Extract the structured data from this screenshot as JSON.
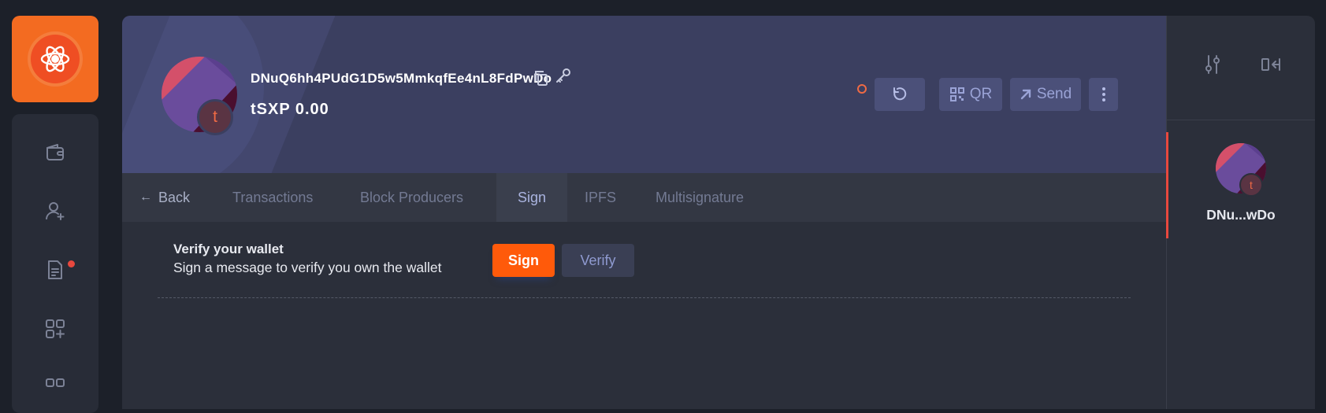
{
  "app": {
    "brand_color": "#f36b21",
    "logo_icon": "ark-logo-icon"
  },
  "left_nav": {
    "items": [
      {
        "name": "wallet-icon",
        "label": ""
      },
      {
        "name": "add-contact-icon",
        "label": ""
      },
      {
        "name": "document-icon",
        "label": "",
        "has_notification": true
      },
      {
        "name": "plugins-add-icon",
        "label": ""
      },
      {
        "name": "apps-grid-icon",
        "label": ""
      }
    ]
  },
  "wallet": {
    "address": "DNuQ6hh4PUdG1D5w5MmkqfEe4nL8FdPwDo",
    "balance": "tSXP 0.00",
    "avatar_letter": "t",
    "short_address": "DNu...wDo"
  },
  "header_actions": {
    "refresh_icon": "refresh-icon",
    "qr_label": "QR",
    "send_label": "Send",
    "more_icon": "more-vertical-icon"
  },
  "tabs": {
    "back_label": "Back",
    "items": [
      {
        "label": "Transactions",
        "active": false
      },
      {
        "label": "Block Producers",
        "active": false
      },
      {
        "label": "Sign",
        "active": true
      },
      {
        "label": "IPFS",
        "active": false
      },
      {
        "label": "Multisignature",
        "active": false
      }
    ]
  },
  "sign_section": {
    "title": "Verify your wallet",
    "description": "Sign a message to verify you own the wallet",
    "sign_button": "Sign",
    "verify_button": "Verify"
  },
  "colors": {
    "accent_orange": "#ff5a0a",
    "header_bg": "#3b3f60",
    "notification_red": "#e8483e"
  }
}
